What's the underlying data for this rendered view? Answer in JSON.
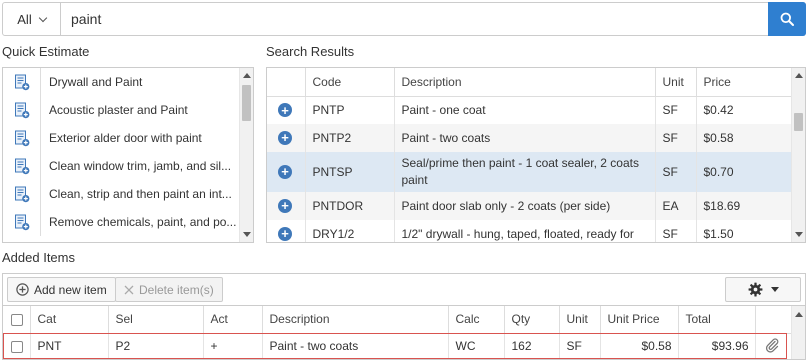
{
  "search": {
    "scope_label": "All",
    "query_value": "paint"
  },
  "quick_estimate": {
    "title": "Quick Estimate",
    "items": [
      {
        "label": "Drywall and Paint"
      },
      {
        "label": "Acoustic plaster and Paint"
      },
      {
        "label": "Exterior alder door with paint"
      },
      {
        "label": "Clean window trim, jamb, and sil..."
      },
      {
        "label": "Clean, strip and then paint an int..."
      },
      {
        "label": "Remove chemicals, paint, and po..."
      }
    ]
  },
  "search_results": {
    "title": "Search Results",
    "columns": {
      "code": "Code",
      "description": "Description",
      "unit": "Unit",
      "price": "Price"
    },
    "rows": [
      {
        "code": "PNTP",
        "description": "Paint - one coat",
        "unit": "SF",
        "price": "$0.42"
      },
      {
        "code": "PNTP2",
        "description": "Paint - two coats",
        "unit": "SF",
        "price": "$0.58"
      },
      {
        "code": "PNTSP",
        "description": "Seal/prime then paint - 1 coat sealer, 2 coats paint",
        "unit": "SF",
        "price": "$0.70"
      },
      {
        "code": "PNTDOR",
        "description": "Paint door slab only - 2 coats (per side)",
        "unit": "EA",
        "price": "$18.69"
      },
      {
        "code": "DRY1/2",
        "description": "1/2\" drywall - hung, taped, floated, ready for",
        "unit": "SF",
        "price": "$1.50"
      }
    ]
  },
  "added_items": {
    "title": "Added Items",
    "add_new_label": "Add new item",
    "delete_label": "Delete item(s)",
    "columns": {
      "cat": "Cat",
      "sel": "Sel",
      "act": "Act",
      "description": "Description",
      "calc": "Calc",
      "qty": "Qty",
      "unit": "Unit",
      "unit_price": "Unit Price",
      "total": "Total"
    },
    "rows": [
      {
        "cat": "PNT",
        "sel": "P2",
        "act": "+",
        "description": "Paint - two coats",
        "calc": "WC",
        "qty": "162",
        "unit": "SF",
        "unit_price": "$0.58",
        "total": "$93.96"
      }
    ]
  },
  "colors": {
    "accent": "#2f7fd0",
    "price_link": "#2a6db5",
    "selected_row": "#dde8f3",
    "selection_outline": "#d9534f"
  },
  "icons": [
    "chevron-down-icon",
    "search-icon",
    "estimate-document-icon",
    "add-circle-icon",
    "plus-circle-icon",
    "close-icon",
    "gear-icon",
    "caret-down-icon",
    "paperclip-icon"
  ]
}
